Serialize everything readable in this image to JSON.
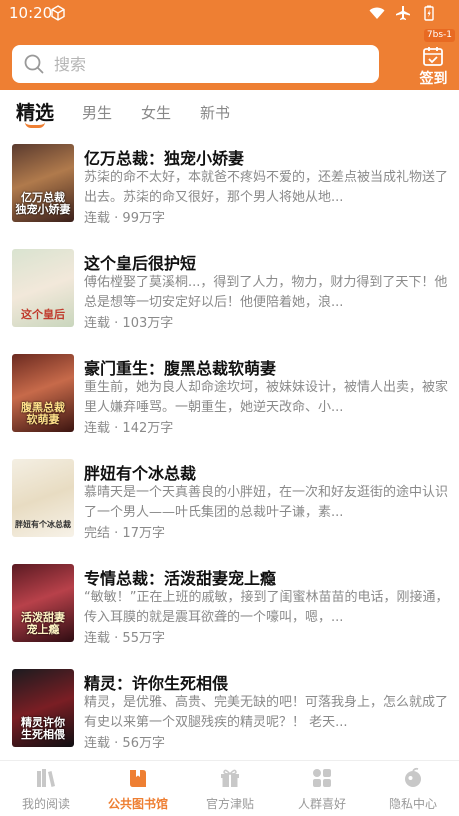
{
  "status_bar": {
    "time": "10:20"
  },
  "search": {
    "placeholder": "搜索"
  },
  "signin": {
    "badge": "7bs-1",
    "label": "签到"
  },
  "tabs": [
    {
      "label": "精选",
      "active": true
    },
    {
      "label": "男生",
      "active": false
    },
    {
      "label": "女生",
      "active": false
    },
    {
      "label": "新书",
      "active": false
    }
  ],
  "books": [
    {
      "title": "亿万总裁：独宠小娇妻",
      "description": "苏柒的命不太好，本就爸不疼妈不爱的，还差点被当成礼物送了出去。苏柒的命又很好，那个男人将她从地...",
      "status": "连载",
      "words": "99万字",
      "cover_text": "亿万总裁 独宠小娇妻"
    },
    {
      "title": "这个皇后很护短",
      "description": "傅佑樘娶了莫溪桐...，得到了人力，物力，财力得到了天下！他总是想等一切安定好以后！他便陪着她，浪...",
      "status": "连载",
      "words": "103万字",
      "cover_text": "这个皇后"
    },
    {
      "title": "豪门重生：腹黑总裁软萌妻",
      "description": "重生前，她为良人却命途坎坷，被妹妹设计，被情人出卖，被家里人嫌弃唾骂。一朝重生，她逆天改命、小...",
      "status": "连载",
      "words": "142万字",
      "cover_text": "腹黑总裁 软萌妻"
    },
    {
      "title": "胖妞有个冰总裁",
      "description": "慕晴天是一个天真善良的小胖妞，在一次和好友逛街的途中认识了一个男人——叶氏集团的总裁叶子谦，素...",
      "status": "完结",
      "words": "17万字",
      "cover_text": "胖妞有个冰总裁"
    },
    {
      "title": "专情总裁：活泼甜妻宠上瘾",
      "description": "“敏敏！”正在上班的戚敏，接到了闺蜜林苗苗的电话，刚接通，传入耳膜的就是震耳欲聋的一个嚎叫，嗯，...",
      "status": "连载",
      "words": "55万字",
      "cover_text": "活泼甜妻 宠上瘾"
    },
    {
      "title": "精灵：许你生死相偎",
      "description": "精灵，是优雅、高贵、完美无缺的吧！可落我身上，怎么就成了有史以来第一个双腿残疾的精灵呢？！ 老天...",
      "status": "连载",
      "words": "56万字",
      "cover_text": "精灵许你 生死相偎"
    }
  ],
  "bottom_nav": [
    {
      "label": "我的阅读",
      "icon": "books-icon",
      "active": false
    },
    {
      "label": "公共图书馆",
      "icon": "library-icon",
      "active": true
    },
    {
      "label": "官方津贴",
      "icon": "gift-icon",
      "active": false
    },
    {
      "label": "人群喜好",
      "icon": "grid-icon",
      "active": false
    },
    {
      "label": "隐私中心",
      "icon": "privacy-icon",
      "active": false
    }
  ],
  "colors": {
    "accent": "#ee7f33",
    "muted_text": "#8a8a8a"
  }
}
